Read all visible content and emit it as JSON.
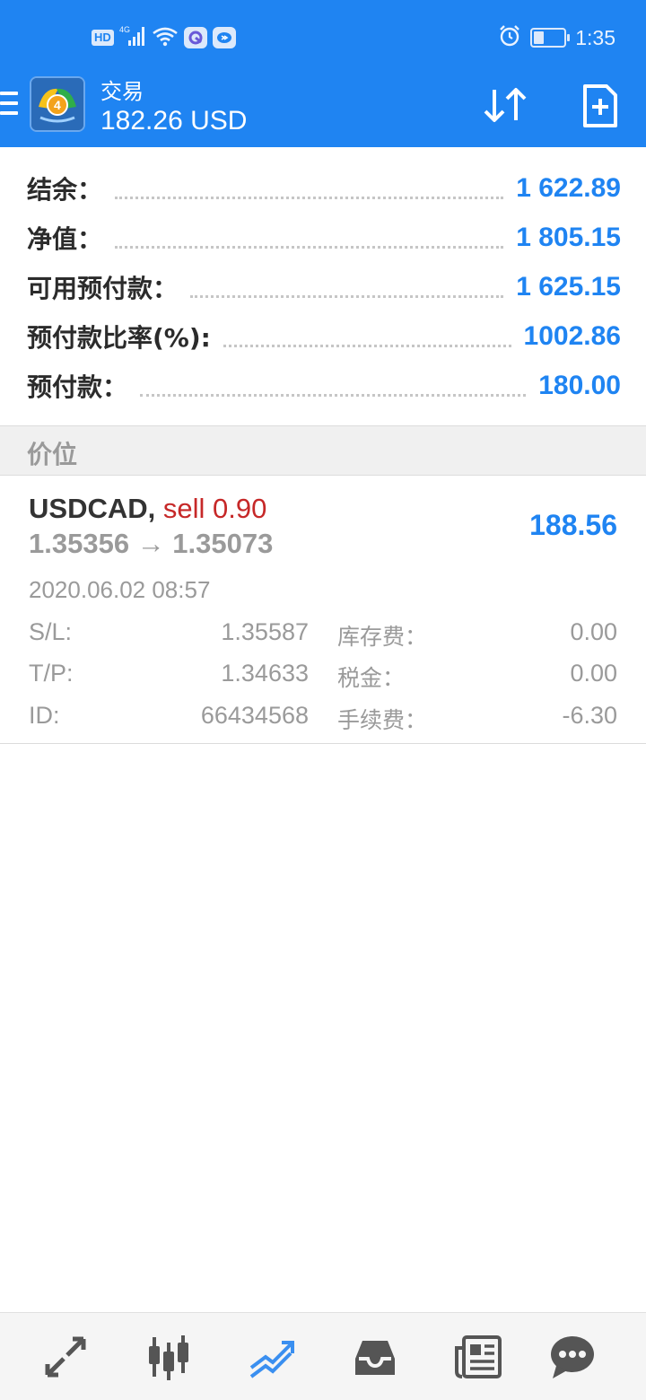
{
  "status_bar": {
    "network": "HD",
    "signal": "4G",
    "time": "1:35",
    "battery_level": 0.35,
    "icons": [
      "hd-icon",
      "signal-icon",
      "wifi-icon",
      "app-notification-icon",
      "chat-notification-icon",
      "alarm-icon",
      "battery-icon"
    ]
  },
  "app_bar": {
    "title": "交易",
    "balance": "182.26 USD",
    "icons": [
      "menu-icon",
      "app-logo",
      "sort-icon",
      "new-order-icon"
    ]
  },
  "summary": [
    {
      "label": "结余：",
      "value": "1 622.89"
    },
    {
      "label": "净值：",
      "value": "1 805.15"
    },
    {
      "label": "可用预付款：",
      "value": "1 625.15"
    },
    {
      "label": "预付款比率(%):",
      "value": "1002.86"
    },
    {
      "label": "预付款：",
      "value": "180.00"
    }
  ],
  "positions_section": {
    "title": "价位"
  },
  "order": {
    "symbol": "USDCAD,",
    "type": "sell 0.90",
    "prices": "1.35356 → 1.35073",
    "profit": "188.56",
    "time": "2020.06.02 08:57",
    "details": [
      {
        "label": "S/L:",
        "value": "1.35587",
        "label2": "库存费：",
        "value2": "0.00"
      },
      {
        "label": "T/P:",
        "value": "1.34633",
        "label2": "税金：",
        "value2": "0.00"
      },
      {
        "label": "ID:",
        "value": "66434568",
        "label2": "手续费：",
        "value2": "-6.30"
      }
    ]
  },
  "bottom_nav": {
    "items": [
      "quotes-icon",
      "chart-icon",
      "trade-icon",
      "history-icon",
      "news-icon",
      "chat-icon"
    ],
    "active": "trade-icon"
  },
  "colors": {
    "primary": "#1f84f2",
    "sell": "#c62828",
    "text_dark": "#2b2b2b",
    "text_muted": "#9a9a9a"
  }
}
